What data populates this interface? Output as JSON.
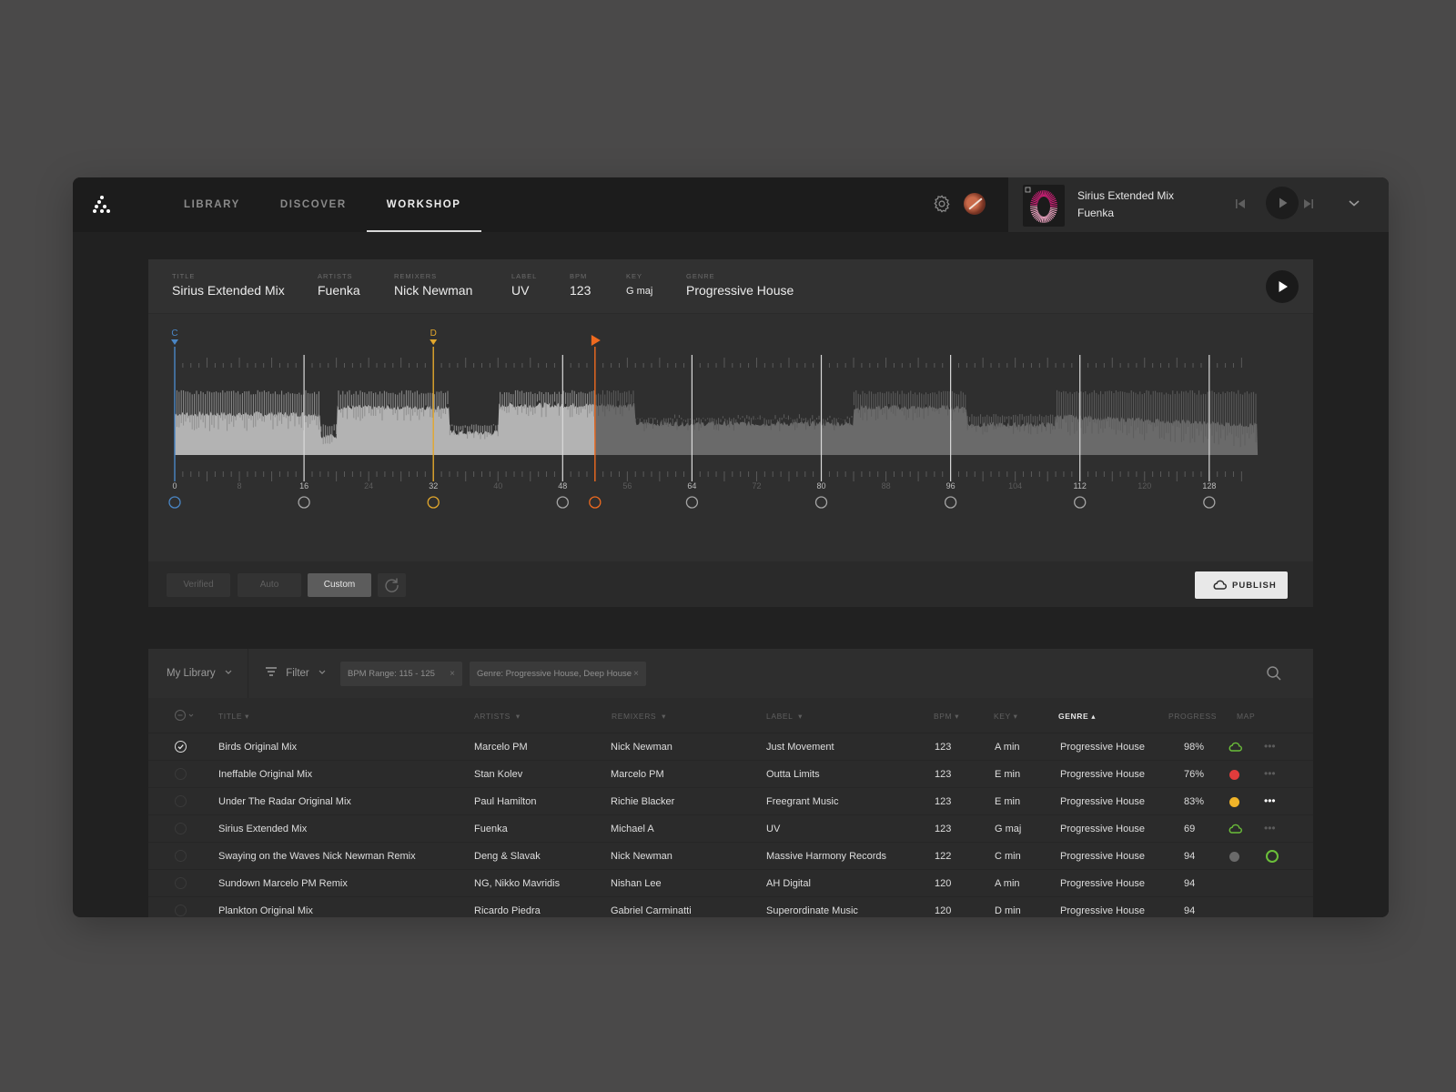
{
  "nav": {
    "items": [
      {
        "label": "LIBRARY",
        "active": false
      },
      {
        "label": "DISCOVER",
        "active": false
      },
      {
        "label": "WORKSHOP",
        "active": true
      }
    ]
  },
  "now_playing": {
    "title": "Sirius Extended Mix",
    "artist": "Fuenka"
  },
  "track_meta": [
    {
      "label": "TITLE",
      "value": "Sirius Extended Mix"
    },
    {
      "label": "ARTISTS",
      "value": "Fuenka"
    },
    {
      "label": "REMIXERS",
      "value": "Nick Newman"
    },
    {
      "label": "LABEL",
      "value": "UV"
    },
    {
      "label": "BPM",
      "value": "123"
    },
    {
      "label": "KEY",
      "value": "G maj"
    },
    {
      "label": "GENRE",
      "value": "Progressive House"
    }
  ],
  "waveform": {
    "bar_labels": [
      "0",
      "8",
      "16",
      "24",
      "32",
      "40",
      "48",
      "56",
      "64",
      "72",
      "80",
      "88",
      "96",
      "104",
      "112",
      "120",
      "128"
    ],
    "total_bars": 134,
    "cue_points": [
      {
        "letter": "C",
        "bar": 0,
        "color": "#4a86c5"
      },
      {
        "letter": "D",
        "bar": 32,
        "color": "#e2a72c"
      }
    ],
    "playhead_bar": 52,
    "playhead_color": "#ef6a1f",
    "marker_bars": [
      16,
      48,
      64,
      80,
      96,
      112,
      128
    ],
    "zoom_window": {
      "start": 0.397,
      "end": 0.713
    }
  },
  "editor_footer": {
    "modes": [
      {
        "label": "Verified",
        "active": false
      },
      {
        "label": "Auto",
        "active": false
      },
      {
        "label": "Custom",
        "active": true
      }
    ],
    "publish_label": "PUBLISH"
  },
  "library": {
    "source": "My Library",
    "filter_label": "Filter",
    "chips": [
      {
        "label": "BPM Range: 115 - 125"
      },
      {
        "label": "Genre: Progressive House, Deep House"
      }
    ],
    "columns": [
      {
        "key": "title",
        "label": "TITLE",
        "sort": "desc"
      },
      {
        "key": "artists",
        "label": "ARTISTS",
        "sort": "desc"
      },
      {
        "key": "remixers",
        "label": "REMIXERS",
        "sort": "desc"
      },
      {
        "key": "label",
        "label": "LABEL",
        "sort": "desc"
      },
      {
        "key": "bpm",
        "label": "BPM",
        "sort": "desc"
      },
      {
        "key": "key",
        "label": "KEY",
        "sort": "desc"
      },
      {
        "key": "genre",
        "label": "GENRE",
        "sort": "asc",
        "sorted": true
      },
      {
        "key": "progress",
        "label": "PROGRESS"
      },
      {
        "key": "map",
        "label": "MAP"
      }
    ],
    "rows": [
      {
        "checked": true,
        "title": "Birds Original Mix",
        "artists": "Marcelo PM",
        "remixers": "Nick Newman",
        "label": "Just Movement",
        "bpm": "123",
        "key": "A min",
        "genre": "Progressive House",
        "progress": "98%",
        "map": "cloud",
        "map_color": "#6bbf3a",
        "action": "more"
      },
      {
        "checked": false,
        "title": "Ineffable Original Mix",
        "artists": "Stan Kolev",
        "remixers": "Marcelo PM",
        "label": "Outta Limits",
        "bpm": "123",
        "key": "E min",
        "genre": "Progressive House",
        "progress": "76%",
        "map": "dot",
        "map_color": "#e23c3c",
        "action": "more"
      },
      {
        "checked": false,
        "title": "Under The Radar Original Mix",
        "artists": "Paul Hamilton",
        "remixers": "Richie Blacker",
        "label": "Freegrant Music",
        "bpm": "123",
        "key": "E min",
        "genre": "Progressive House",
        "progress": "83%",
        "map": "dot",
        "map_color": "#f0b429",
        "action": "more-active"
      },
      {
        "checked": false,
        "title": "Sirius Extended Mix",
        "artists": "Fuenka",
        "remixers": "Michael A",
        "label": "UV",
        "bpm": "123",
        "key": "G maj",
        "genre": "Progressive House",
        "progress": "69",
        "map": "cloud",
        "map_color": "#6bbf3a",
        "action": "more"
      },
      {
        "checked": false,
        "title": "Swaying on the Waves Nick Newman Remix",
        "artists": "Deng & Slavak",
        "remixers": "Nick Newman",
        "label": "Massive Harmony Records",
        "bpm": "122",
        "key": "C min",
        "genre": "Progressive House",
        "progress": "94",
        "map": "dot",
        "map_color": "#6a6a6a",
        "action": "loading"
      },
      {
        "checked": false,
        "title": "Sundown Marcelo PM Remix",
        "artists": "NG, Nikko Mavridis",
        "remixers": "Nishan Lee",
        "label": "AH Digital",
        "bpm": "120",
        "key": "A min",
        "genre": "Progressive House",
        "progress": "94",
        "map": "",
        "action": ""
      },
      {
        "checked": false,
        "title": "Plankton Original Mix",
        "artists": "Ricardo Piedra",
        "remixers": "Gabriel Carminatti",
        "label": "Superordinate Music",
        "bpm": "120",
        "key": "D min",
        "genre": "Progressive House",
        "progress": "94",
        "map": "",
        "action": ""
      }
    ]
  }
}
